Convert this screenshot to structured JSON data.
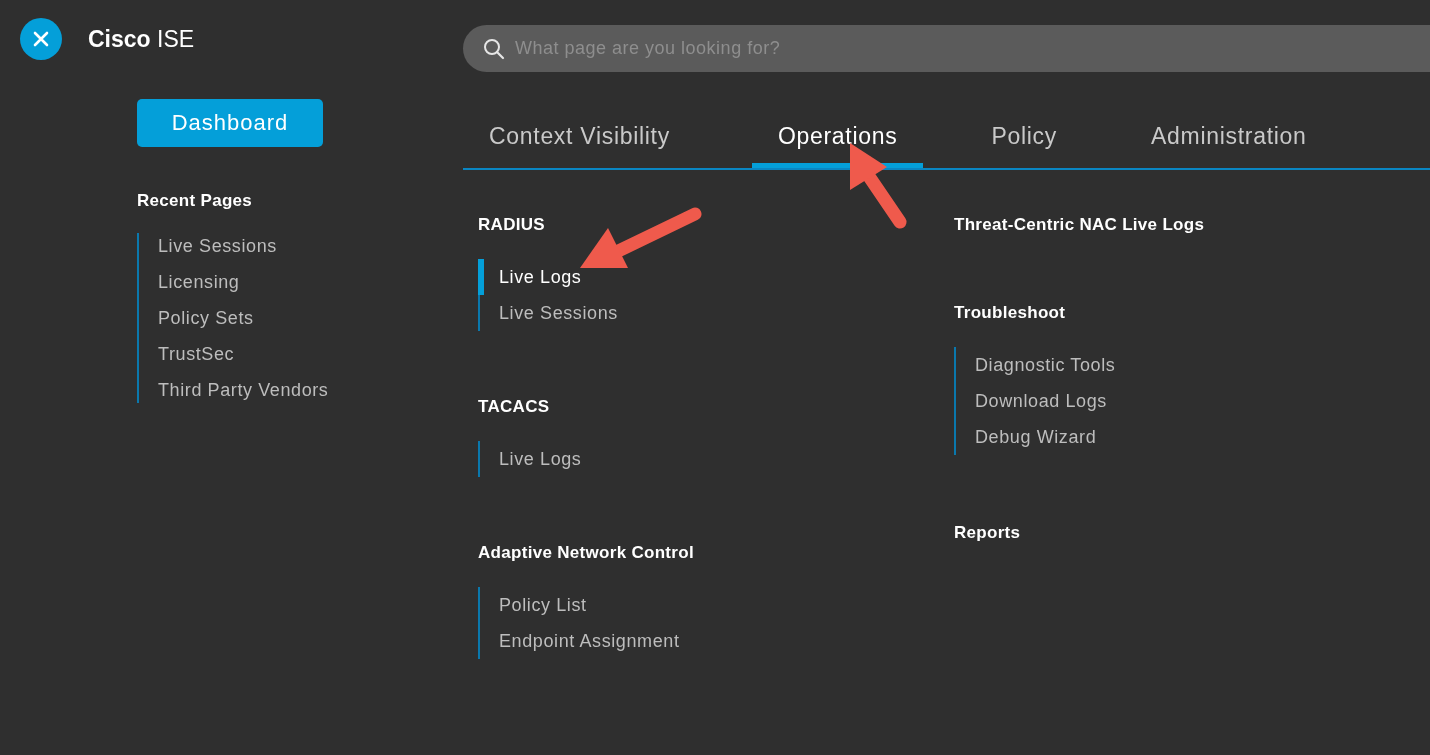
{
  "app": {
    "brand": "Cisco",
    "product": "ISE"
  },
  "dashboard_button": "Dashboard",
  "recent_pages": {
    "heading": "Recent Pages",
    "items": [
      "Live Sessions",
      "Licensing",
      "Policy Sets",
      "TrustSec",
      "Third Party Vendors"
    ]
  },
  "search": {
    "placeholder": "What page are you looking for?"
  },
  "tabs": [
    {
      "label": "Context Visibility",
      "selected": false
    },
    {
      "label": "Operations",
      "selected": true
    },
    {
      "label": "Policy",
      "selected": false
    },
    {
      "label": "Administration",
      "selected": false
    }
  ],
  "menu_columns": [
    [
      {
        "heading": "RADIUS",
        "items": [
          {
            "label": "Live Logs",
            "selected": true
          },
          {
            "label": "Live Sessions",
            "selected": false
          }
        ]
      },
      {
        "heading": "TACACS",
        "items": [
          {
            "label": "Live Logs",
            "selected": false
          }
        ]
      },
      {
        "heading": "Adaptive Network Control",
        "items": [
          {
            "label": "Policy List",
            "selected": false
          },
          {
            "label": "Endpoint Assignment",
            "selected": false
          }
        ]
      }
    ],
    [
      {
        "heading": "Threat-Centric NAC Live Logs"
      },
      {
        "heading": "Troubleshoot",
        "items": [
          {
            "label": "Diagnostic Tools",
            "selected": false
          },
          {
            "label": "Download Logs",
            "selected": false
          },
          {
            "label": "Debug Wizard",
            "selected": false
          }
        ]
      },
      {
        "heading": "Reports"
      }
    ]
  ]
}
